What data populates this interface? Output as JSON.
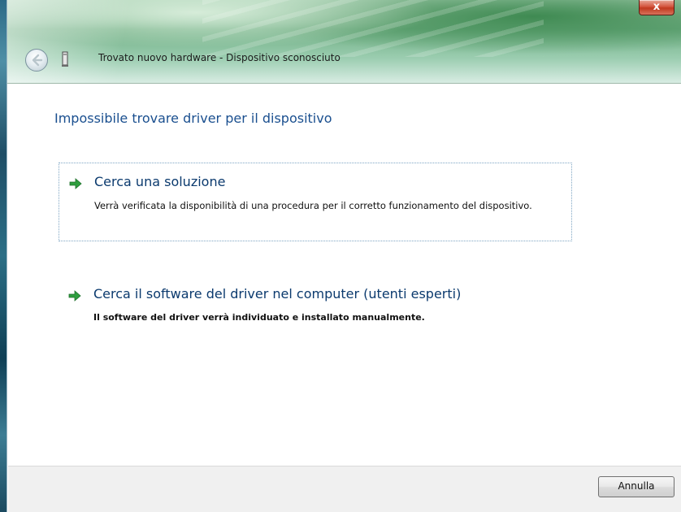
{
  "window": {
    "title": "Trovato nuovo hardware - Dispositivo sconosciuto",
    "close_label": "x"
  },
  "content": {
    "heading": "Impossibile trovare driver per il dispositivo",
    "options": [
      {
        "title": "Cerca una soluzione",
        "description": "Verrà verificata la disponibilità di una procedura per il corretto funzionamento del dispositivo.",
        "icon": "green-arrow-icon"
      },
      {
        "title": "Cerca il software del driver nel computer (utenti esperti)",
        "description": "Il software del driver verrà individuato e installato manualmente.",
        "icon": "green-arrow-icon"
      }
    ]
  },
  "footer": {
    "cancel_label": "Annulla"
  },
  "colors": {
    "heading": "#1a4f8f",
    "link": "#0b3a6e",
    "arrow": "#2e9e3e"
  }
}
